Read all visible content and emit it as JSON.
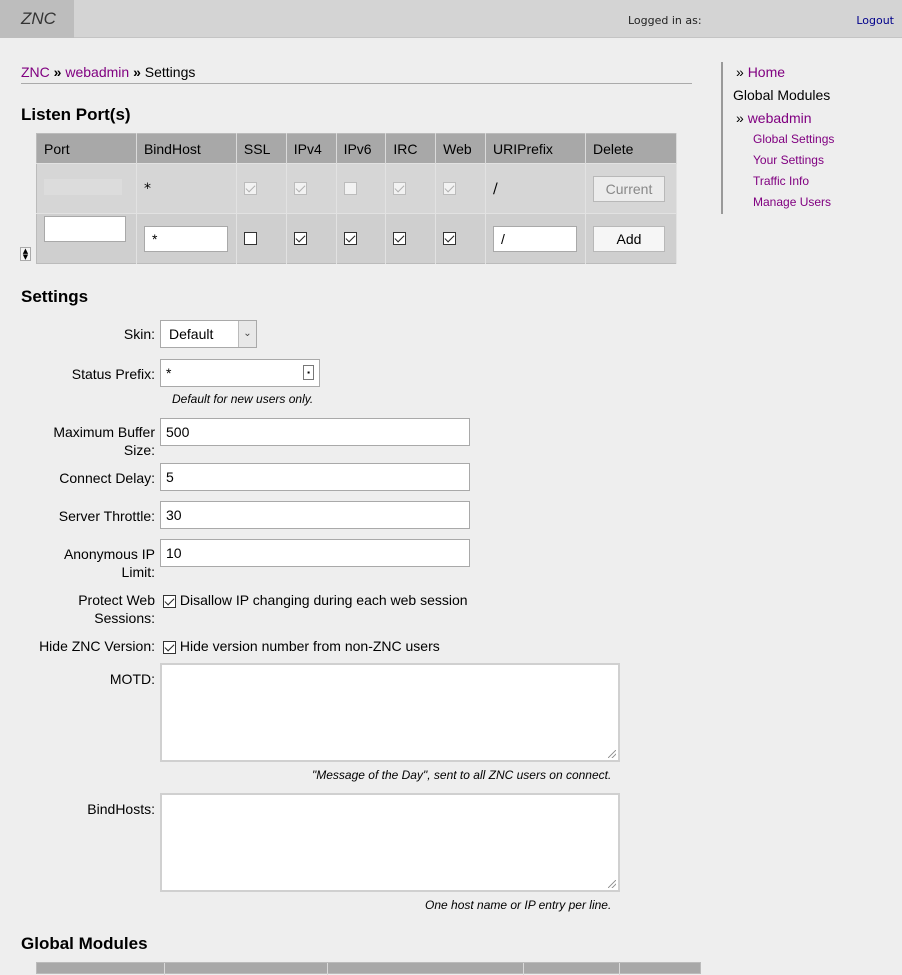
{
  "header": {
    "logo": "ZNC",
    "logged_in_label": "Logged in as:",
    "logout_label": "Logout"
  },
  "breadcrumb": {
    "root": "ZNC",
    "sep": "»",
    "module": "webadmin",
    "page": "Settings"
  },
  "listen": {
    "title": "Listen Port(s)",
    "columns": [
      "Port",
      "BindHost",
      "SSL",
      "IPv4",
      "IPv6",
      "IRC",
      "Web",
      "URIPrefix",
      "Delete"
    ],
    "existing": {
      "bindhost": "*",
      "ssl": true,
      "ipv4": true,
      "ipv6": false,
      "irc": true,
      "web": true,
      "uriprefix": "/",
      "button": "Current"
    },
    "new": {
      "port": "",
      "bindhost": "*",
      "ssl": false,
      "ipv4": true,
      "ipv6": true,
      "irc": true,
      "web": true,
      "uriprefix": "/",
      "button": "Add"
    }
  },
  "settings": {
    "title": "Settings",
    "skin_label": "Skin:",
    "skin_value": "Default",
    "status_prefix_label": "Status Prefix:",
    "status_prefix_value": "*",
    "status_prefix_hint": "Default for new users only.",
    "max_buffer_label_1": "Maximum Buffer",
    "max_buffer_label_2": "Size:",
    "max_buffer_value": "500",
    "connect_delay_label": "Connect Delay:",
    "connect_delay_value": "5",
    "server_throttle_label": "Server Throttle:",
    "server_throttle_value": "30",
    "anon_ip_label_1": "Anonymous IP",
    "anon_ip_label_2": "Limit:",
    "anon_ip_value": "10",
    "protect_label_1": "Protect Web",
    "protect_label_2": "Sessions:",
    "protect_text": "Disallow IP changing during each web session",
    "hide_version_label": "Hide ZNC Version:",
    "hide_version_text": "Hide version number from non-ZNC users",
    "motd_label": "MOTD:",
    "motd_hint": "\"Message of the Day\", sent to all ZNC users on connect.",
    "bindhosts_label": "BindHosts:",
    "bindhosts_hint": "One host name or IP entry per line."
  },
  "global_modules": {
    "title": "Global Modules"
  },
  "sidebar": {
    "home": "Home",
    "section": "Global Modules",
    "webadmin": "webadmin",
    "items": [
      "Global Settings",
      "Your Settings",
      "Traffic Info",
      "Manage Users"
    ]
  }
}
